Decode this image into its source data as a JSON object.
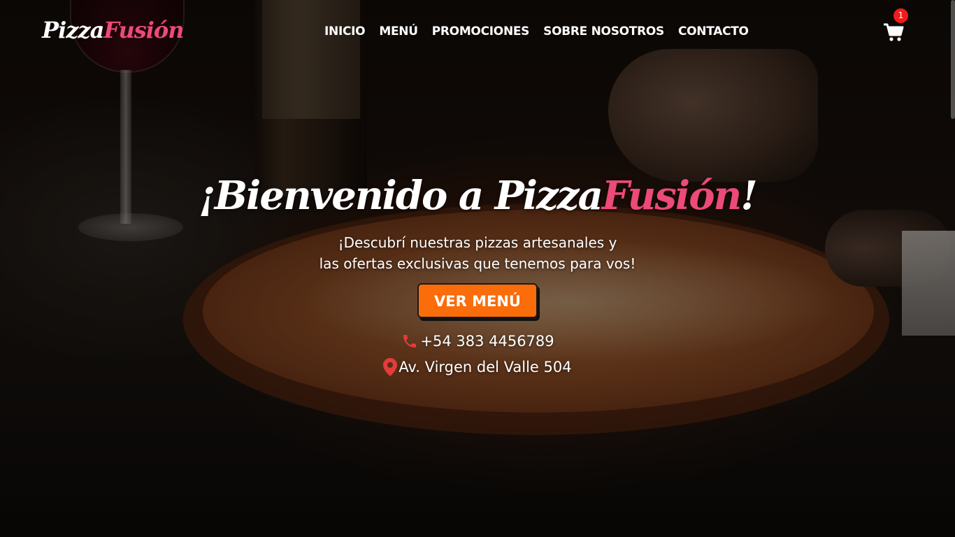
{
  "brand": {
    "name_part1": "Pizza",
    "name_part2": "Fusión"
  },
  "nav": {
    "items": [
      {
        "label": "INICIO"
      },
      {
        "label": "MENÚ"
      },
      {
        "label": "PROMOCIONES"
      },
      {
        "label": "SOBRE NOSOTROS"
      },
      {
        "label": "CONTACTO"
      }
    ]
  },
  "cart": {
    "icon": "shopping-cart-icon",
    "count": "1"
  },
  "hero": {
    "title_prefix": "¡Bienvenido a ",
    "title_brand_white": "Pizza",
    "title_brand_pink": "Fusión",
    "title_suffix": "!",
    "subtitle_line1": "¡Descubrí nuestras pizzas artesanales y",
    "subtitle_line2": "las ofertas exclusivas que tenemos para vos!",
    "cta_label": "VER MENÚ",
    "phone": "+54 383 4456789",
    "address": "Av. Virgen del Valle 504"
  },
  "colors": {
    "accent_pink": "#ec4a78",
    "cta_orange": "#fb6c0b",
    "icon_red": "#e53b3b",
    "badge_red": "#f21b1b"
  }
}
